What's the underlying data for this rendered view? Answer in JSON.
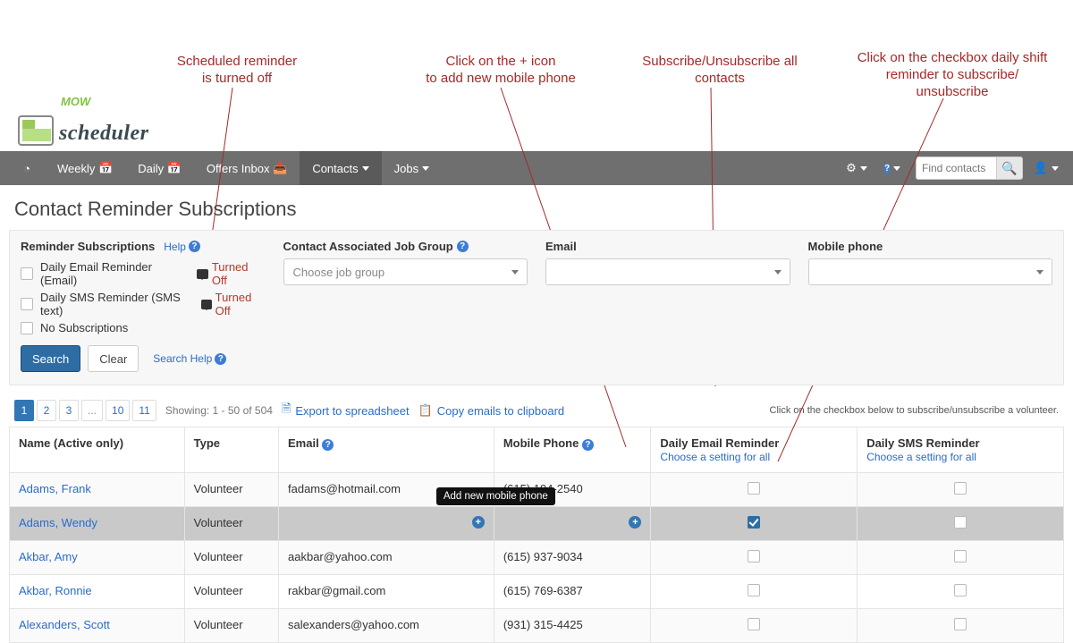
{
  "annotations": {
    "a1_l1": "Scheduled reminder",
    "a1_l2": "is turned off",
    "a2_l1": "Click on the + icon",
    "a2_l2": "to add new mobile phone",
    "a3_l1": "Subscribe/Unsubscribe all",
    "a3_l2": "contacts",
    "a4_l1": "Click on the checkbox daily shift",
    "a4_l2": "reminder to subscribe/",
    "a4_l3": "unsubscribe"
  },
  "logo": {
    "mow": "MOW",
    "scheduler": "scheduler"
  },
  "nav": {
    "weekly": "Weekly",
    "daily": "Daily",
    "offers": "Offers Inbox",
    "contacts": "Contacts",
    "jobs": "Jobs",
    "search_placeholder": "Find contacts"
  },
  "page_title": "Contact Reminder Subscriptions",
  "filters": {
    "reminder_label": "Reminder Subscriptions",
    "help_label": "Help",
    "opt_email": "Daily Email Reminder (Email)",
    "opt_sms": "Daily SMS Reminder (SMS text)",
    "opt_none": "No Subscriptions",
    "turned_off": "Turned Off",
    "job_group_label": "Contact Associated Job Group",
    "job_group_placeholder": "Choose job group",
    "email_label": "Email",
    "mobile_label": "Mobile phone",
    "search_btn": "Search",
    "clear_btn": "Clear",
    "search_help": "Search Help"
  },
  "pagination": {
    "p1": "1",
    "p2": "2",
    "p3": "3",
    "ell": "...",
    "p10": "10",
    "p11": "11",
    "showing": "Showing: 1 - 50 of 504",
    "export": "Export to spreadsheet",
    "copy_emails": "Copy emails to clipboard"
  },
  "table": {
    "hint": "Click on the checkbox below to subscribe/unsubscribe a volunteer.",
    "col_name": "Name (Active only)",
    "col_type": "Type",
    "col_email": "Email",
    "col_phone": "Mobile Phone",
    "col_der": "Daily Email Reminder",
    "col_dsr": "Daily SMS Reminder",
    "choose_all": "Choose a setting for all",
    "tooltip_add_phone": "Add new mobile phone",
    "rows": [
      {
        "name": "Adams, Frank",
        "type": "Volunteer",
        "email": "fadams@hotmail.com",
        "phone": "(615) 194-2540",
        "der": false,
        "dsr": false
      },
      {
        "name": "Adams, Wendy",
        "type": "Volunteer",
        "email": "",
        "phone": "",
        "der": true,
        "dsr": false
      },
      {
        "name": "Akbar, Amy",
        "type": "Volunteer",
        "email": "aakbar@yahoo.com",
        "phone": "(615) 937-9034",
        "der": false,
        "dsr": false
      },
      {
        "name": "Akbar, Ronnie",
        "type": "Volunteer",
        "email": "rakbar@gmail.com",
        "phone": "(615) 769-6387",
        "der": false,
        "dsr": false
      },
      {
        "name": "Alexanders, Scott",
        "type": "Volunteer",
        "email": "salexanders@yahoo.com",
        "phone": "(931) 315-4425",
        "der": false,
        "dsr": false
      }
    ]
  }
}
